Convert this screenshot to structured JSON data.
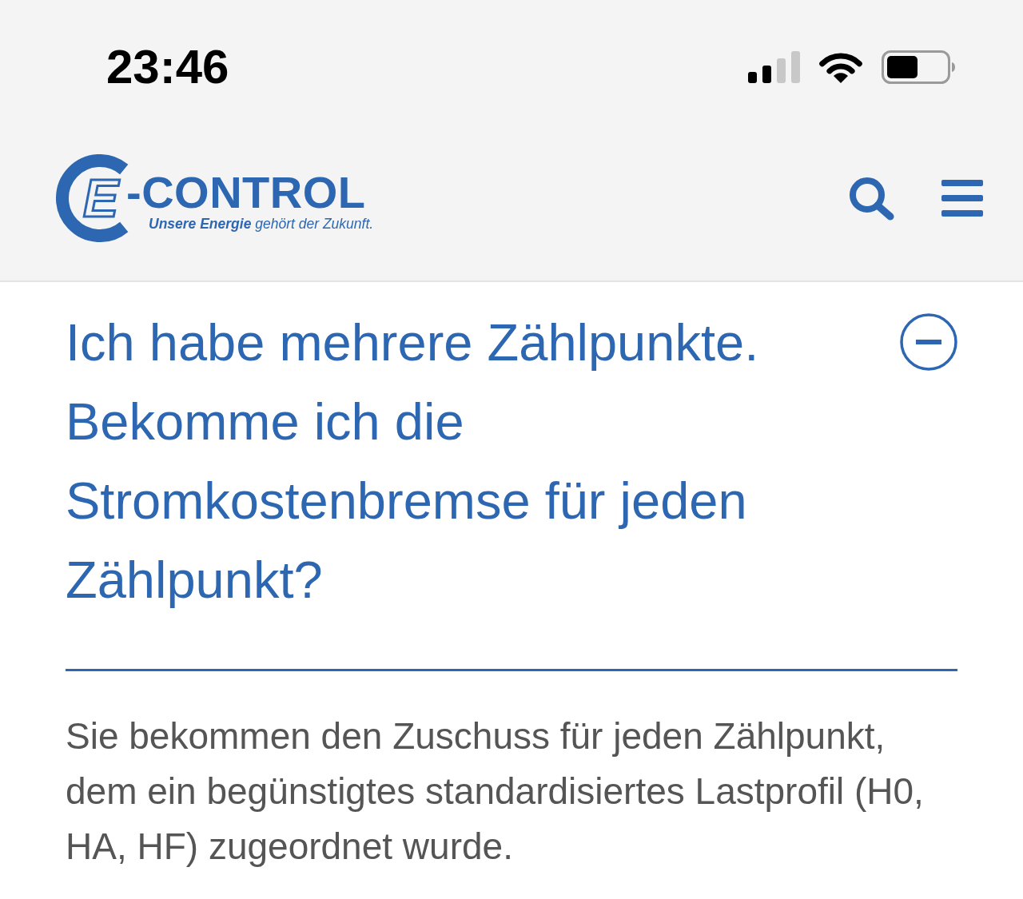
{
  "status_bar": {
    "time": "23:46"
  },
  "header": {
    "logo": {
      "letter": "E",
      "wordmark": "-CONTROL",
      "tagline": "**Unsere Energie** gehört der Zukunft."
    }
  },
  "faq": {
    "question": "Ich habe mehrere Zählpunkte. Bekomme ich die Stromkostenbremse für jeden Zählpunkt?",
    "expanded": true,
    "answer": "Sie bekommen den Zuschuss für jeden Zählpunkt, dem ein begünstigtes standardisiertes Lastprofil (H0, HA, HF) zugeordnet wurde."
  }
}
